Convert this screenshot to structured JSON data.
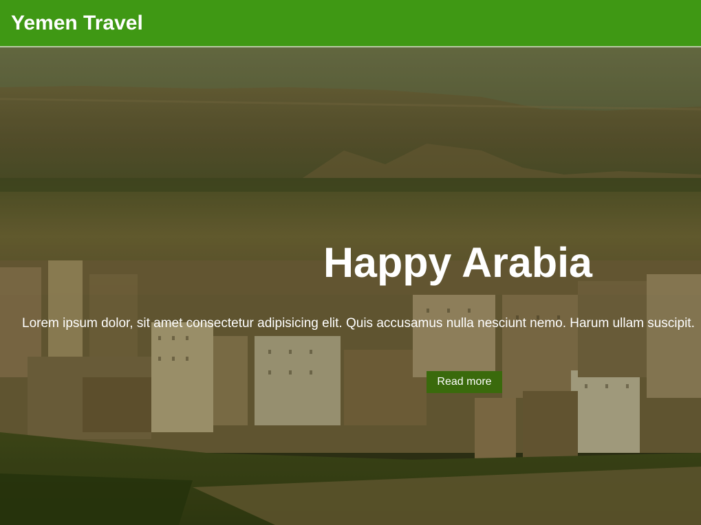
{
  "navbar": {
    "brand": "Yemen Travel",
    "background_color": "#3f9814"
  },
  "hero": {
    "title": "Happy Arabia",
    "text": "Lorem ipsum dolor, sit amet consectetur adipisicing elit. Quis accusamus nulla nesciunt nemo. Harum ullam suscipit.",
    "button_label": "Read more",
    "button_color": "#3a6a0c",
    "image_description_icon": "city-landscape-photo"
  }
}
